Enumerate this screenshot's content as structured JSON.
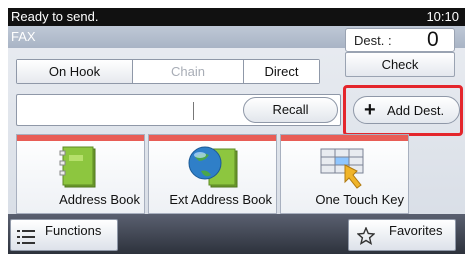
{
  "status": {
    "message": "Ready to send.",
    "time": "10:10"
  },
  "title": "FAX",
  "destination": {
    "label": "Dest. :",
    "count": "0"
  },
  "buttons": {
    "check": "Check",
    "on_hook": "On Hook",
    "chain": "Chain",
    "direct": "Direct",
    "recall": "Recall",
    "add_dest": "Add Dest.",
    "functions": "Functions",
    "favorites": "Favorites"
  },
  "tiles": [
    {
      "label": "Address Book",
      "icon": "address-book-icon"
    },
    {
      "label": "Ext Address Book",
      "icon": "ext-address-book-icon"
    },
    {
      "label": "One Touch Key",
      "icon": "one-touch-key-icon"
    }
  ],
  "colors": {
    "highlight": "#e4262c",
    "tile_bar": "#e85d56"
  }
}
